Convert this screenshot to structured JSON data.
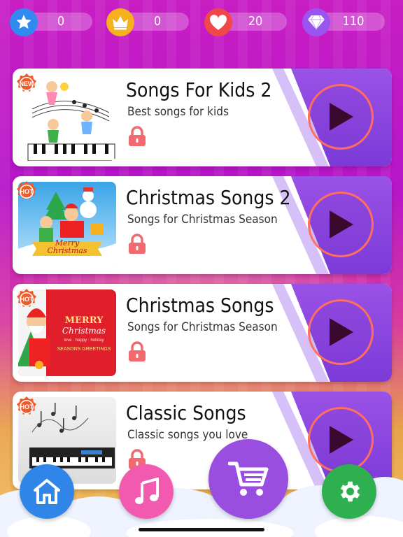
{
  "stats": {
    "stars": "0",
    "crowns": "0",
    "hearts": "20",
    "diamonds": "110"
  },
  "songs": [
    {
      "badge": "NEW",
      "title": "Songs For Kids 2",
      "subtitle": "Best songs for kids"
    },
    {
      "badge": "HOT",
      "title": "Christmas Songs 2",
      "subtitle": "Songs for Christmas Season"
    },
    {
      "badge": "HOT",
      "title": "Christmas Songs",
      "subtitle": "Songs for Christmas Season"
    },
    {
      "badge": "HOT",
      "title": "Classic Songs",
      "subtitle": "Classic songs you love"
    }
  ],
  "thumb_text": {
    "merry_christmas_1": "Merry",
    "merry_christmas_2": "Christmas",
    "card3_merry": "MERRY",
    "card3_christmas": "Christmas",
    "card3_words": "love · happy · holiday",
    "card3_greetings": "SEASONS GREETINGS"
  },
  "icons": {
    "stat_star": "star-icon",
    "stat_crown": "crown-icon",
    "stat_heart": "heart-icon",
    "stat_diamond": "diamond-icon",
    "lock": "lock-icon",
    "play": "play-icon",
    "nav_home": "home-icon",
    "nav_music": "music-note-icon",
    "nav_shop": "cart-icon",
    "nav_settings": "gear-icon"
  },
  "colors": {
    "star": "#2f8bf0",
    "crown": "#f6b21e",
    "heart": "#f04848",
    "diamond": "#9a55f0",
    "card_accent": "#8a45de",
    "play_ring": "#ff6e5e",
    "home": "#2f86e8",
    "music": "#f25ab0",
    "shop": "#9a4ee0",
    "settings": "#2fb050"
  }
}
